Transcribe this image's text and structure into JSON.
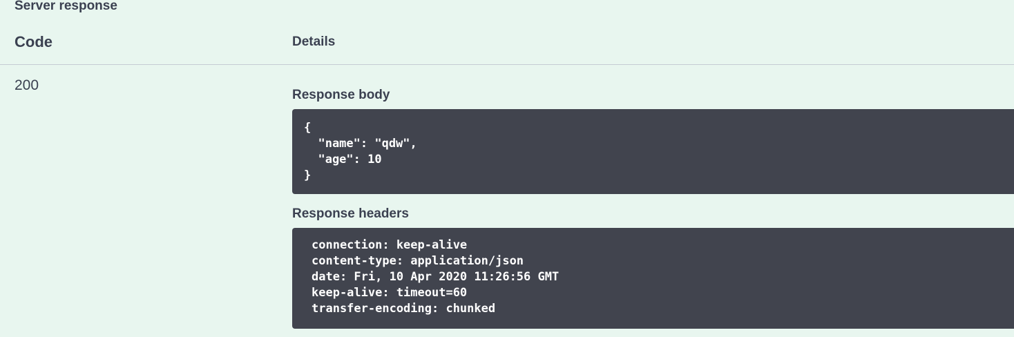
{
  "section": {
    "title": "Server response"
  },
  "table": {
    "code_header": "Code",
    "details_header": "Details"
  },
  "response": {
    "status_code": "200",
    "body_label": "Response body",
    "body": "{\n  \"name\": \"qdw\",\n  \"age\": 10\n}",
    "headers_label": "Response headers",
    "headers": "connection: keep-alive\ncontent-type: application/json\ndate: Fri, 10 Apr 2020 11:26:56 GMT\nkeep-alive: timeout=60\ntransfer-encoding: chunked"
  },
  "colors": {
    "background": "#e8f6ef",
    "text": "#3b4151",
    "code_background": "#41444e",
    "code_text": "#ffffff"
  }
}
